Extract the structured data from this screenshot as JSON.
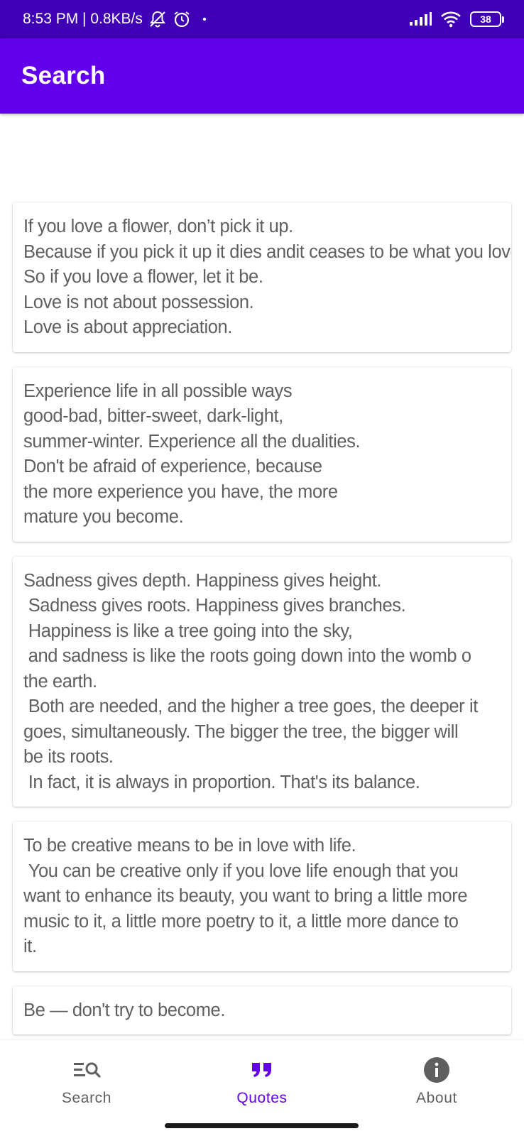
{
  "status_bar": {
    "time_speed": "8:53 PM | 0.8KB/s",
    "battery_level": "38",
    "icons": [
      "mute-icon",
      "alarm-icon",
      "dot-icon",
      "signal-icon",
      "wifi-icon",
      "battery-icon"
    ]
  },
  "app_bar": {
    "title": "Search",
    "color": "#6200ee"
  },
  "quotes": [
    {
      "text": "If you love a flower, don’t pick it up.\nBecause if you pick it up it dies andit ceases to be what you love.\nSo if you love a flower, let it be.\nLove is not about possession.\nLove is about appreciation."
    },
    {
      "text": "Experience life in all possible ways\ngood-bad, bitter-sweet, dark-light,\nsummer-winter. Experience all the dualities.\nDon't be afraid of experience, because\nthe more experience you have, the more\nmature you become."
    },
    {
      "text": "Sadness gives depth. Happiness gives height.\n Sadness gives roots. Happiness gives branches.\n Happiness is like a tree going into the sky,\n and sadness is like the roots going down into the womb o\nthe earth.\n Both are needed, and the higher a tree goes, the deeper it\ngoes, simultaneously. The bigger the tree, the bigger will\nbe its roots.\n In fact, it is always in proportion. That's its balance."
    },
    {
      "text": "To be creative means to be in love with life.\n You can be creative only if you love life enough that you\nwant to enhance its beauty, you want to bring a little more\nmusic to it, a little more poetry to it, a little more dance to\nit."
    },
    {
      "text": "Be — don't try to become."
    }
  ],
  "bottom_nav": {
    "items": [
      {
        "label": "Search",
        "icon": "search-list-icon",
        "active": false
      },
      {
        "label": "Quotes",
        "icon": "quote-icon",
        "active": true
      },
      {
        "label": "About",
        "icon": "info-icon",
        "active": false
      }
    ],
    "active_color": "#6200ee",
    "inactive_color": "#5f5f5f"
  }
}
